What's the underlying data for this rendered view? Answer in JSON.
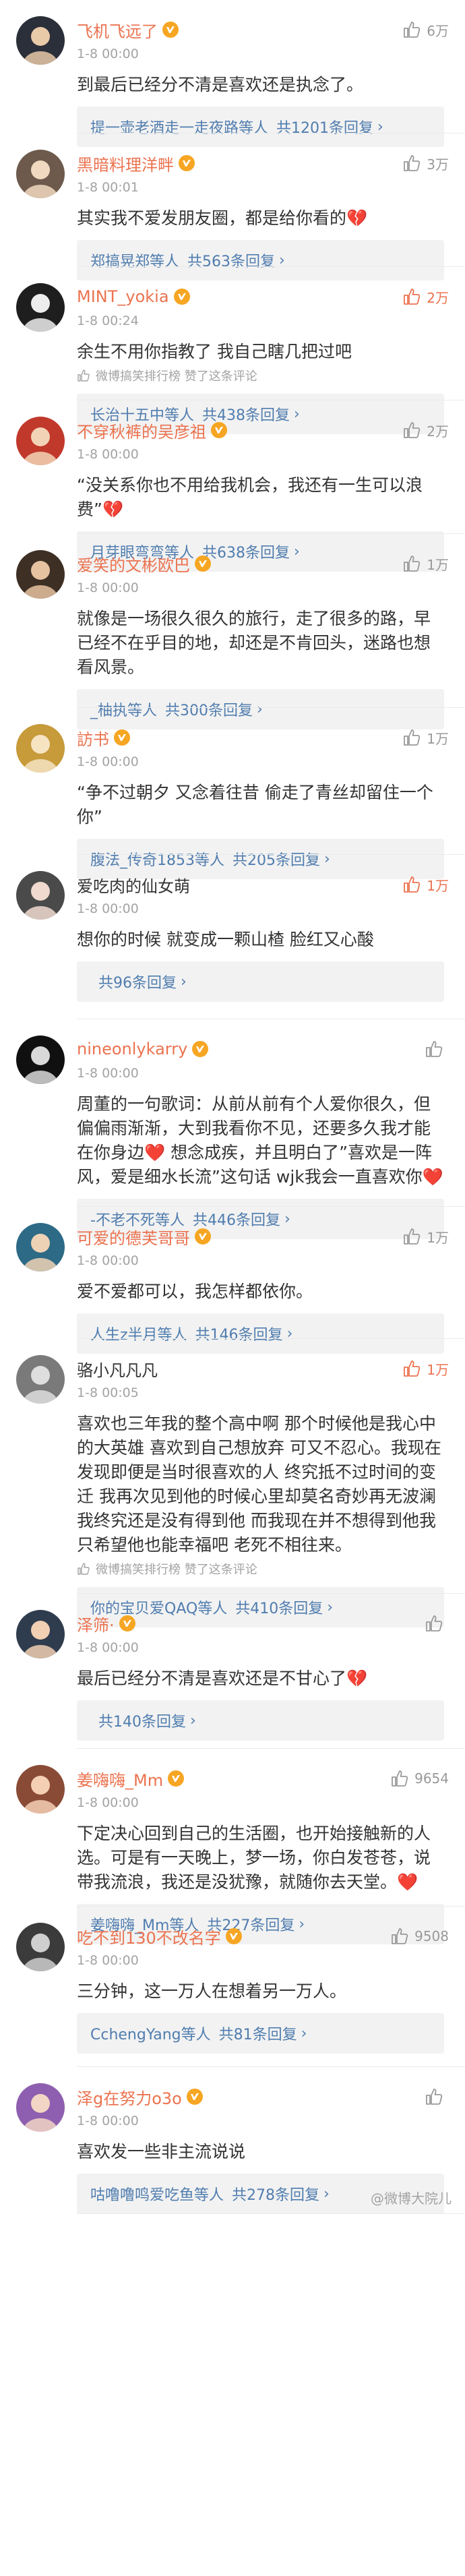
{
  "colors": {
    "name_vip": "#eb7350",
    "link": "#507daf",
    "meta": "#a3a3a3",
    "reply_bg": "#f2f2f2"
  },
  "watermark": "@微博大院儿",
  "comments": [
    {
      "name": "飞机飞远了",
      "vip": true,
      "time": "1-8 00:00",
      "likes": "6万",
      "hot": false,
      "content": "到最后已经分不清是喜欢还是执念了。",
      "tail": "",
      "reply_user": "提一壶老酒走一走夜路等人",
      "reply_count": "共1201条回复",
      "avatar": [
        "#2b2f3a",
        "#e8c9a8"
      ]
    },
    {
      "name": "黑暗料理洋畔",
      "vip": true,
      "time": "1-8 00:01",
      "likes": "3万",
      "hot": false,
      "content": "其实我不爱发朋友圈，都是给你看的💔",
      "tail": "",
      "reply_user": "郑搞晃郑等人",
      "reply_count": "共563条回复",
      "avatar": [
        "#6d5a4c",
        "#f1d8c0"
      ]
    },
    {
      "name": "MINT_yokia",
      "vip": true,
      "time": "1-8 00:24",
      "likes": "2万",
      "hot": true,
      "content": "余生不用你指教了 我自己瞎几把过吧",
      "tail": "微博搞笑排行榜 赞了这条评论",
      "reply_user": "长治十五中等人",
      "reply_count": "共438条回复",
      "avatar": [
        "#1e1e1e",
        "#ededed"
      ]
    },
    {
      "name": "不穿秋裤的吴彦祖",
      "vip": true,
      "time": "1-8 00:00",
      "likes": "2万",
      "hot": false,
      "content": "“没关系你也不用给我机会，我还有一生可以浪费”💔",
      "tail": "",
      "reply_user": "月芽眼弯弯等人",
      "reply_count": "共638条回复",
      "avatar": [
        "#c0392b",
        "#f3d3b6"
      ]
    },
    {
      "name": "爱笑的文彬欧巴",
      "vip": true,
      "time": "1-8 00:00",
      "likes": "1万",
      "hot": false,
      "content": "就像是一场很久很久的旅行，走了很多的路，早已经不在乎目的地，却还是不肯回头，迷路也想看风景。",
      "tail": "",
      "reply_user": "_柚执等人",
      "reply_count": "共300条回复",
      "avatar": [
        "#3e2f25",
        "#e6c2a0"
      ]
    },
    {
      "name": "訪书",
      "vip": true,
      "time": "1-8 00:00",
      "likes": "1万",
      "hot": false,
      "content": "“争不过朝夕 又念着往昔 偷走了青丝却留住一个你”",
      "tail": "",
      "reply_user": "腹法_传奇1853等人",
      "reply_count": "共205条回复",
      "avatar": [
        "#c79a3a",
        "#f5e3c2"
      ]
    },
    {
      "name": "爱吃肉的仙女萌",
      "vip": false,
      "time": "1-8 00:00",
      "likes": "1万",
      "hot": true,
      "content": "想你的时候 就变成一颗山楂 脸红又心酸",
      "tail": "",
      "reply_user": "",
      "reply_count": "共96条回复",
      "avatar": [
        "#4a4a4a",
        "#f0d9cf"
      ]
    },
    {
      "name": "nineonlykarry",
      "vip": true,
      "time": "1-8 00:00",
      "likes": "",
      "hot": false,
      "content": "周董的一句歌词：从前从前有个人爱你很久，但偏偏雨渐渐，大到我看你不见，还要多久我才能在你身边❤️ 想念成疾，并且明白了”喜欢是一阵风，爱是细水长流”这句话 wjk我会一直喜欢你❤️",
      "tail": "",
      "reply_user": "-不老不死等人",
      "reply_count": "共446条回复",
      "avatar": [
        "#101010",
        "#d9d9d9"
      ]
    },
    {
      "name": "可爱的德芙哥哥",
      "vip": true,
      "time": "1-8 00:00",
      "likes": "1万",
      "hot": false,
      "content": "爱不爱都可以，我怎样都依你。",
      "tail": "",
      "reply_user": "人生z半月等人",
      "reply_count": "共146条回复",
      "avatar": [
        "#2d6a86",
        "#eed2b5"
      ]
    },
    {
      "name": "骆小凡凡凡",
      "vip": false,
      "time": "1-8 00:05",
      "likes": "1万",
      "hot": true,
      "content": "喜欢也三年我的整个高中啊 那个时候他是我心中的大英雄 喜欢到自己想放弃 可又不忍心。我现在发现即便是当时很喜欢的人 终究抵不过时间的变迁 我再次见到他的时候心里却莫名奇妙再无波澜 我终究还是没有得到他 而我现在并不想得到他我只希望他也能幸福吧 老死不相往来。",
      "tail": "微博搞笑排行榜 赞了这条评论",
      "reply_user": "你的宝贝爱QAQ等人",
      "reply_count": "共410条回复",
      "avatar": [
        "#7a7a7a",
        "#dedede"
      ]
    },
    {
      "name": "泽筛·",
      "vip": true,
      "time": "1-8 00:00",
      "likes": "",
      "hot": false,
      "content": "最后已经分不清是喜欢还是不甘心了💔",
      "tail": "",
      "reply_user": "",
      "reply_count": "共140条回复",
      "avatar": [
        "#2f3c4e",
        "#f0cfb3"
      ]
    },
    {
      "name": "姜嗨嗨_Mm",
      "vip": true,
      "time": "1-8 00:00",
      "likes": "9654",
      "hot": false,
      "content": "下定决心回到自己的生活圈，也开始接触新的人选。可是有一天晚上，梦一场，你白发苍苍，说带我流浪，我还是没犹豫，就随你去天堂。❤️",
      "tail": "",
      "reply_user": "姜嗨嗨_Mm等人",
      "reply_count": "共227条回复",
      "avatar": [
        "#8a4b36",
        "#f4cfb4"
      ]
    },
    {
      "name": "吃不到130不改名字",
      "vip": true,
      "time": "1-8 00:00",
      "likes": "9508",
      "hot": false,
      "content": "三分钟，这一万人在想着另一万人。",
      "tail": "",
      "reply_user": "CchengYang等人",
      "reply_count": "共81条回复",
      "avatar": [
        "#3b3b3b",
        "#cfcfcf"
      ]
    },
    {
      "name": "泽g在努力o3o",
      "vip": true,
      "time": "1-8 00:00",
      "likes": "",
      "hot": false,
      "content": "喜欢发一些非主流说说",
      "tail": "",
      "reply_user": "咕噜噜鸣爱吃鱼等人",
      "reply_count": "共278条回复",
      "avatar": [
        "#8e5fb0",
        "#f2d5c4"
      ]
    }
  ]
}
